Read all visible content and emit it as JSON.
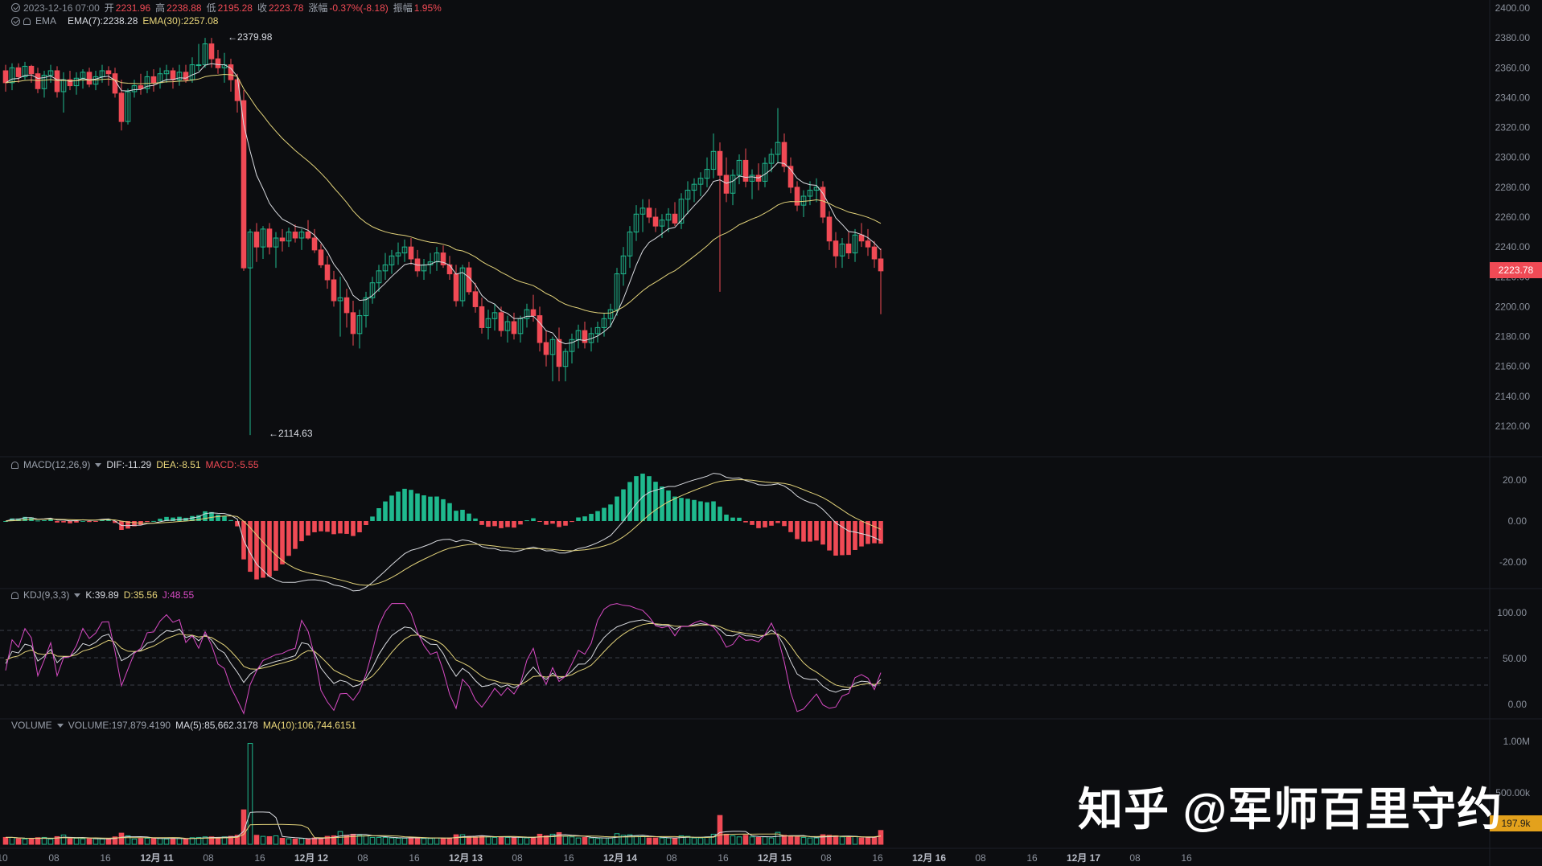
{
  "header": {
    "date": "2023-12-16 07:00",
    "open_label": "开",
    "open": "2231.96",
    "high_label": "高",
    "high": "2238.88",
    "low_label": "低",
    "low": "2195.28",
    "close_label": "收",
    "close": "2223.78",
    "change_label": "涨幅",
    "change": "-0.37%(-8.18)",
    "amp_label": "振幅",
    "amp": "1.95%"
  },
  "ema_row": {
    "name": "EMA",
    "ema7": "EMA(7):2238.28",
    "ema30": "EMA(30):2257.08"
  },
  "macd_row": {
    "name": "MACD(12,26,9)",
    "dif": "DIF:-11.29",
    "dea": "DEA:-8.51",
    "macd": "MACD:-5.55"
  },
  "kdj_row": {
    "name": "KDJ(9,3,3)",
    "k": "K:39.89",
    "d": "D:35.56",
    "j": "J:48.55"
  },
  "volume_row": {
    "name": "VOLUME",
    "volume": "VOLUME:197,879.4190",
    "ma5": "MA(5):85,662.3178",
    "ma10": "MA(10):106,744.6151"
  },
  "markers": {
    "high": "2379.98",
    "low": "2114.63"
  },
  "current_price_tag": "2223.78",
  "current_volume_tag": "197.9k",
  "price_axis": [
    "2400.00",
    "2380.00",
    "2360.00",
    "2340.00",
    "2320.00",
    "2300.00",
    "2280.00",
    "2260.00",
    "2240.00",
    "2220.00",
    "2200.00",
    "2180.00",
    "2160.00",
    "2140.00",
    "2120.00"
  ],
  "macd_axis": [
    "20.00",
    "0.00",
    "-20.00"
  ],
  "kdj_axis": [
    "100.00",
    "50.00",
    "0.00"
  ],
  "volume_axis": [
    "1.00M",
    "500.00k"
  ],
  "time_axis": [
    "10",
    "08",
    "16",
    "12月 11",
    "08",
    "16",
    "12月 12",
    "08",
    "16",
    "12月 13",
    "08",
    "16",
    "12月 14",
    "08",
    "16",
    "12月 15",
    "08",
    "16",
    "12月 16",
    "08",
    "16",
    "12月 17",
    "08",
    "16"
  ],
  "watermark": "知乎 @军师百里守约",
  "colors": {
    "up": "#1fb98e",
    "down": "#f04a55",
    "ema7": "#d9dbe0",
    "ema30": "#e2d27a",
    "kdj_j": "#d94bc5",
    "bg": "#0c0d10",
    "price_tag": "#f04a55",
    "vol_tag": "#e3a11c"
  },
  "chart_data": {
    "type": "candlestick",
    "interval": "1h",
    "candles_ohlc": [
      [
        2358,
        2362,
        2344,
        2350
      ],
      [
        2350,
        2363,
        2345,
        2360
      ],
      [
        2360,
        2363,
        2350,
        2354
      ],
      [
        2354,
        2364,
        2352,
        2361
      ],
      [
        2361,
        2362,
        2350,
        2356
      ],
      [
        2356,
        2360,
        2343,
        2346
      ],
      [
        2346,
        2358,
        2340,
        2355
      ],
      [
        2355,
        2362,
        2350,
        2358
      ],
      [
        2358,
        2361,
        2340,
        2344
      ],
      [
        2344,
        2357,
        2330,
        2352
      ],
      [
        2352,
        2358,
        2345,
        2348
      ],
      [
        2348,
        2357,
        2342,
        2353
      ],
      [
        2353,
        2359,
        2346,
        2357
      ],
      [
        2357,
        2360,
        2347,
        2349
      ],
      [
        2349,
        2358,
        2345,
        2354
      ],
      [
        2354,
        2362,
        2350,
        2358
      ],
      [
        2358,
        2361,
        2348,
        2356
      ],
      [
        2356,
        2360,
        2340,
        2343
      ],
      [
        2343,
        2352,
        2318,
        2324
      ],
      [
        2324,
        2346,
        2322,
        2344
      ],
      [
        2344,
        2352,
        2340,
        2348
      ],
      [
        2348,
        2356,
        2342,
        2346
      ],
      [
        2346,
        2358,
        2343,
        2354
      ],
      [
        2354,
        2359,
        2344,
        2350
      ],
      [
        2350,
        2360,
        2346,
        2356
      ],
      [
        2356,
        2362,
        2350,
        2358
      ],
      [
        2358,
        2360,
        2346,
        2352
      ],
      [
        2352,
        2362,
        2348,
        2357
      ],
      [
        2357,
        2362,
        2350,
        2352
      ],
      [
        2352,
        2367,
        2350,
        2362
      ],
      [
        2362,
        2376,
        2358,
        2362
      ],
      [
        2362,
        2380,
        2360,
        2376
      ],
      [
        2376,
        2380,
        2360,
        2366
      ],
      [
        2366,
        2372,
        2356,
        2360
      ],
      [
        2360,
        2370,
        2350,
        2362
      ],
      [
        2362,
        2366,
        2344,
        2352
      ],
      [
        2352,
        2356,
        2330,
        2338
      ],
      [
        2338,
        2345,
        2224,
        2226
      ],
      [
        2226,
        2252,
        2114,
        2250
      ],
      [
        2250,
        2256,
        2230,
        2240
      ],
      [
        2240,
        2254,
        2232,
        2252
      ],
      [
        2252,
        2256,
        2235,
        2240
      ],
      [
        2240,
        2250,
        2226,
        2246
      ],
      [
        2246,
        2252,
        2237,
        2244
      ],
      [
        2244,
        2253,
        2240,
        2250
      ],
      [
        2250,
        2255,
        2243,
        2246
      ],
      [
        2246,
        2252,
        2238,
        2250
      ],
      [
        2250,
        2258,
        2245,
        2246
      ],
      [
        2246,
        2252,
        2236,
        2238
      ],
      [
        2238,
        2242,
        2226,
        2228
      ],
      [
        2228,
        2234,
        2212,
        2218
      ],
      [
        2218,
        2224,
        2200,
        2204
      ],
      [
        2204,
        2220,
        2180,
        2206
      ],
      [
        2206,
        2212,
        2186,
        2196
      ],
      [
        2196,
        2204,
        2174,
        2182
      ],
      [
        2182,
        2198,
        2172,
        2194
      ],
      [
        2194,
        2210,
        2186,
        2206
      ],
      [
        2206,
        2220,
        2202,
        2216
      ],
      [
        2216,
        2228,
        2210,
        2224
      ],
      [
        2224,
        2236,
        2218,
        2228
      ],
      [
        2228,
        2238,
        2222,
        2234
      ],
      [
        2234,
        2243,
        2228,
        2236
      ],
      [
        2236,
        2245,
        2230,
        2240
      ],
      [
        2240,
        2246,
        2228,
        2232
      ],
      [
        2232,
        2238,
        2220,
        2224
      ],
      [
        2224,
        2232,
        2218,
        2228
      ],
      [
        2228,
        2236,
        2222,
        2230
      ],
      [
        2230,
        2240,
        2224,
        2236
      ],
      [
        2236,
        2241,
        2226,
        2228
      ],
      [
        2228,
        2234,
        2218,
        2222
      ],
      [
        2222,
        2228,
        2200,
        2204
      ],
      [
        2204,
        2228,
        2200,
        2226
      ],
      [
        2226,
        2230,
        2208,
        2210
      ],
      [
        2210,
        2216,
        2196,
        2200
      ],
      [
        2200,
        2206,
        2182,
        2186
      ],
      [
        2186,
        2198,
        2178,
        2192
      ],
      [
        2192,
        2202,
        2184,
        2196
      ],
      [
        2196,
        2200,
        2180,
        2184
      ],
      [
        2184,
        2194,
        2176,
        2190
      ],
      [
        2190,
        2196,
        2178,
        2182
      ],
      [
        2182,
        2194,
        2176,
        2192
      ],
      [
        2192,
        2202,
        2186,
        2198
      ],
      [
        2198,
        2208,
        2190,
        2194
      ],
      [
        2194,
        2200,
        2170,
        2176
      ],
      [
        2176,
        2184,
        2160,
        2168
      ],
      [
        2168,
        2180,
        2150,
        2178
      ],
      [
        2178,
        2186,
        2150,
        2160
      ],
      [
        2160,
        2172,
        2150,
        2170
      ],
      [
        2170,
        2182,
        2162,
        2178
      ],
      [
        2178,
        2188,
        2172,
        2184
      ],
      [
        2184,
        2190,
        2172,
        2176
      ],
      [
        2176,
        2186,
        2170,
        2182
      ],
      [
        2182,
        2190,
        2176,
        2186
      ],
      [
        2186,
        2196,
        2180,
        2192
      ],
      [
        2192,
        2202,
        2186,
        2198
      ],
      [
        2198,
        2226,
        2194,
        2222
      ],
      [
        2222,
        2240,
        2214,
        2234
      ],
      [
        2234,
        2254,
        2226,
        2250
      ],
      [
        2250,
        2268,
        2244,
        2262
      ],
      [
        2262,
        2272,
        2250,
        2266
      ],
      [
        2266,
        2272,
        2256,
        2260
      ],
      [
        2260,
        2266,
        2250,
        2254
      ],
      [
        2254,
        2262,
        2246,
        2258
      ],
      [
        2258,
        2266,
        2250,
        2262
      ],
      [
        2262,
        2270,
        2254,
        2256
      ],
      [
        2256,
        2276,
        2252,
        2272
      ],
      [
        2272,
        2284,
        2262,
        2278
      ],
      [
        2278,
        2286,
        2270,
        2282
      ],
      [
        2282,
        2290,
        2274,
        2286
      ],
      [
        2286,
        2300,
        2280,
        2292
      ],
      [
        2292,
        2316,
        2286,
        2304
      ],
      [
        2304,
        2310,
        2210,
        2288
      ],
      [
        2288,
        2300,
        2270,
        2276
      ],
      [
        2276,
        2292,
        2268,
        2288
      ],
      [
        2288,
        2302,
        2282,
        2298
      ],
      [
        2298,
        2306,
        2280,
        2284
      ],
      [
        2284,
        2292,
        2272,
        2288
      ],
      [
        2288,
        2296,
        2278,
        2284
      ],
      [
        2284,
        2300,
        2280,
        2296
      ],
      [
        2296,
        2306,
        2290,
        2302
      ],
      [
        2302,
        2333,
        2296,
        2310
      ],
      [
        2310,
        2316,
        2290,
        2294
      ],
      [
        2294,
        2300,
        2276,
        2280
      ],
      [
        2280,
        2284,
        2264,
        2268
      ],
      [
        2268,
        2278,
        2260,
        2274
      ],
      [
        2274,
        2284,
        2268,
        2278
      ],
      [
        2278,
        2286,
        2270,
        2280
      ],
      [
        2280,
        2284,
        2256,
        2260
      ],
      [
        2260,
        2264,
        2238,
        2244
      ],
      [
        2244,
        2250,
        2226,
        2234
      ],
      [
        2234,
        2246,
        2226,
        2242
      ],
      [
        2242,
        2250,
        2232,
        2236
      ],
      [
        2236,
        2252,
        2230,
        2248
      ],
      [
        2248,
        2256,
        2240,
        2244
      ],
      [
        2244,
        2252,
        2234,
        2240
      ],
      [
        2240,
        2244,
        2226,
        2232
      ],
      [
        2232,
        2239,
        2195,
        2224
      ]
    ]
  }
}
